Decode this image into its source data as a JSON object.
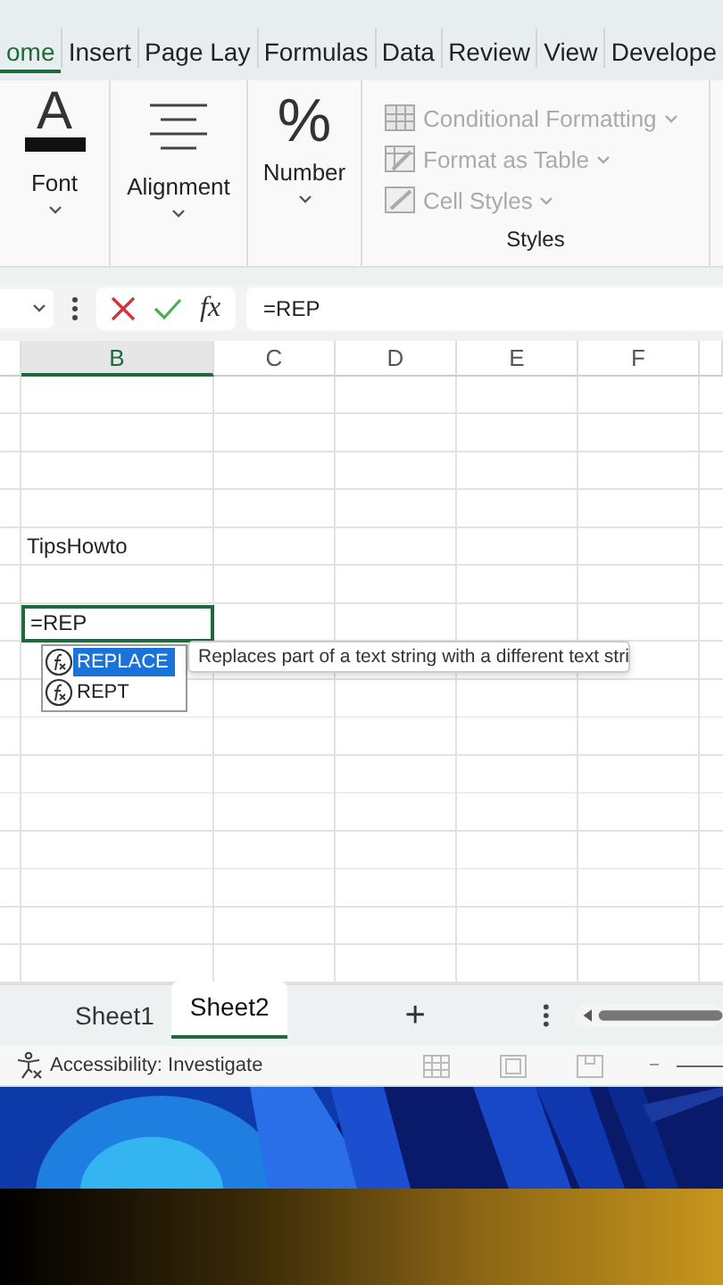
{
  "ribbon_tabs": [
    {
      "label": "ome",
      "selected": true
    },
    {
      "label": "Insert",
      "selected": false
    },
    {
      "label": "Page Lay",
      "selected": false
    },
    {
      "label": "Formulas",
      "selected": false
    },
    {
      "label": "Data",
      "selected": false
    },
    {
      "label": "Review",
      "selected": false
    },
    {
      "label": "View",
      "selected": false
    },
    {
      "label": "Develope",
      "selected": false
    }
  ],
  "ribbon_groups": [
    {
      "kind": "font",
      "icon": "A",
      "label": "Font"
    },
    {
      "kind": "alignment",
      "label": "Alignment"
    },
    {
      "kind": "number",
      "icon": "%",
      "label": "Number"
    }
  ],
  "styles_group": {
    "label": "Styles",
    "items": [
      {
        "kind": "conditional",
        "label": "Conditional Formatting",
        "disabled": true
      },
      {
        "kind": "table",
        "label": "Format as Table",
        "disabled": true
      },
      {
        "kind": "cell",
        "label": "Cell Styles",
        "disabled": true
      }
    ]
  },
  "formula_bar": {
    "function_label": "fx",
    "value": "=REP"
  },
  "columns": [
    {
      "label": "B",
      "selected": true
    },
    {
      "label": "C",
      "selected": false
    },
    {
      "label": "D",
      "selected": false
    },
    {
      "label": "E",
      "selected": false
    },
    {
      "label": "F",
      "selected": false
    }
  ],
  "rows": [
    {
      "kind": "blank"
    },
    {
      "kind": "blank"
    },
    {
      "kind": "blank"
    },
    {
      "kind": "blank"
    },
    {
      "kind": "text",
      "text": "TipsHowto"
    },
    {
      "kind": "blank"
    },
    {
      "kind": "editing",
      "text": "=REP"
    },
    {
      "kind": "blank"
    },
    {
      "kind": "blank"
    },
    {
      "kind": "blank"
    },
    {
      "kind": "blank"
    },
    {
      "kind": "blank"
    },
    {
      "kind": "blank"
    },
    {
      "kind": "blank"
    },
    {
      "kind": "blank"
    },
    {
      "kind": "blank"
    }
  ],
  "autocomplete": {
    "items": [
      {
        "label": "REPLACE",
        "selected": true
      },
      {
        "label": "REPT",
        "selected": false
      }
    ],
    "tooltip": "Replaces part of a text string with a different text stri"
  },
  "sheet_tabs": [
    {
      "label": "Sheet1",
      "selected": false
    },
    {
      "label": "Sheet2",
      "selected": true
    }
  ],
  "add_sheet": "+",
  "status_bar": {
    "accessibility": "Accessibility: Investigate"
  }
}
